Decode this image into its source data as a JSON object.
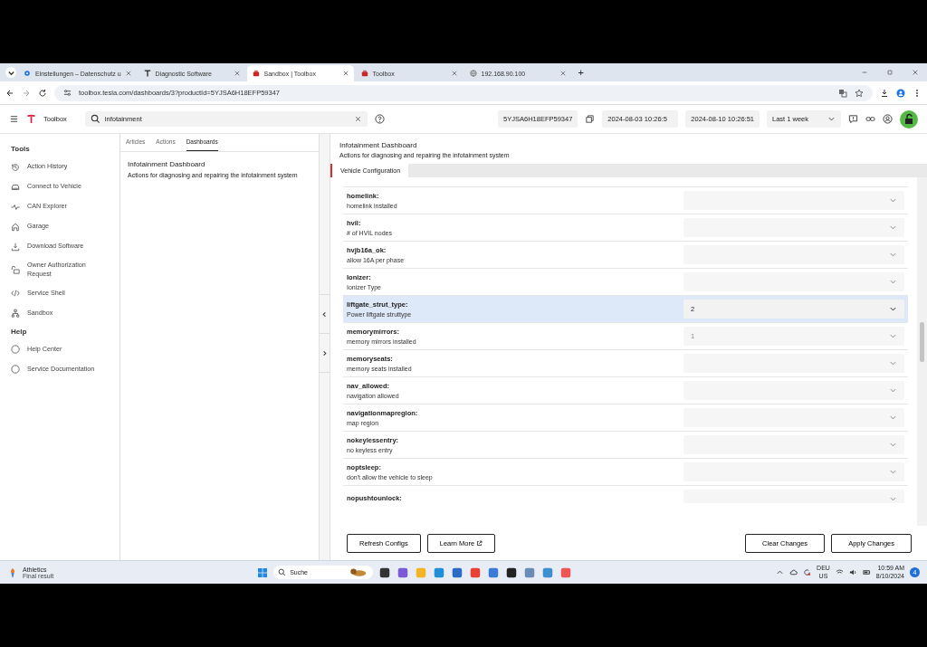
{
  "browser": {
    "tabs": [
      {
        "title": "Einstellungen – Datenschutz u",
        "selected": false
      },
      {
        "title": "Diagnostic Software",
        "selected": false
      },
      {
        "title": "Sandbox | Toolbox",
        "selected": true
      },
      {
        "title": "Toolbox",
        "selected": false
      },
      {
        "title": "192.168.90.100",
        "selected": false
      }
    ],
    "new_tab": "+",
    "url": "toolbox.tesla.com/dashboards/3?productId=5YJSA6H18EFP59347"
  },
  "toolbar": {
    "app_name": "Toolbox",
    "search": {
      "value": "infotainment"
    },
    "product_id": "5YJSA6H18EFP59347",
    "date_from": "2024-08-03 10:26:5",
    "date_to": "2024-08-10 10:26:51",
    "range": "Last 1 week"
  },
  "sidebar": {
    "sections": [
      {
        "title": "Tools",
        "items": [
          "Action History",
          "Connect to Vehicle",
          "CAN Explorer",
          "Garage",
          "Download Software",
          "Owner Authorization Request",
          "Service Shell",
          "Sandbox"
        ]
      },
      {
        "title": "Help",
        "items": [
          "Help Center",
          "Service Documentation"
        ]
      }
    ]
  },
  "content_tabs": [
    {
      "label": "Articles",
      "selected": false
    },
    {
      "label": "Actions",
      "selected": false
    },
    {
      "label": "Dashboards",
      "selected": true
    }
  ],
  "dashboard_card": {
    "title": "Infotainment Dashboard",
    "description": "Actions for diagnosing and repairing the infotainment system"
  },
  "dashboard": {
    "title": "Infotainment Dashboard",
    "description": "Actions for diagnosing and repairing the infotainment system",
    "tab": "Vehicle Configuration",
    "rows": [
      {
        "name": "homelink:",
        "description": "homelink installed",
        "value": "",
        "selected": false
      },
      {
        "name": "hvil:",
        "description": "# of HVIL nodes",
        "value": "",
        "selected": false
      },
      {
        "name": "hvjb16a_ok:",
        "description": "allow 16A per phase",
        "value": "",
        "selected": false
      },
      {
        "name": "Ionizer:",
        "description": "Ionizer Type",
        "value": "",
        "selected": false
      },
      {
        "name": "liftgate_strut_type:",
        "description": "Power liftgate struttype",
        "value": "2",
        "selected": true
      },
      {
        "name": "memorymirrors:",
        "description": "memory mirrors installed",
        "value": "1",
        "selected": false
      },
      {
        "name": "memoryseats:",
        "description": "memory seats installed",
        "value": "",
        "selected": false
      },
      {
        "name": "nav_allowed:",
        "description": "navigation allowed",
        "value": "",
        "selected": false
      },
      {
        "name": "navigationmapregion:",
        "description": "map region",
        "value": "",
        "selected": false
      },
      {
        "name": "nokeylessentry:",
        "description": "no keyless entry",
        "value": "",
        "selected": false
      },
      {
        "name": "noptsleep:",
        "description": "don't allow the vehicle to sleep",
        "value": "",
        "selected": false
      },
      {
        "name": "nopushtounlock:",
        "description": "",
        "value": "",
        "selected": false
      }
    ],
    "left_buttons": [
      "Refresh Configs",
      "Learn More"
    ],
    "right_buttons": [
      "Clear Changes",
      "Apply Changes"
    ]
  },
  "taskbar": {
    "widget_title": "Athletics",
    "widget_subtitle": "Final result",
    "search": "Suche",
    "language": "DEU",
    "layout": "US",
    "time": "10:59 AM",
    "date": "8/10/2024",
    "badge": "4"
  }
}
